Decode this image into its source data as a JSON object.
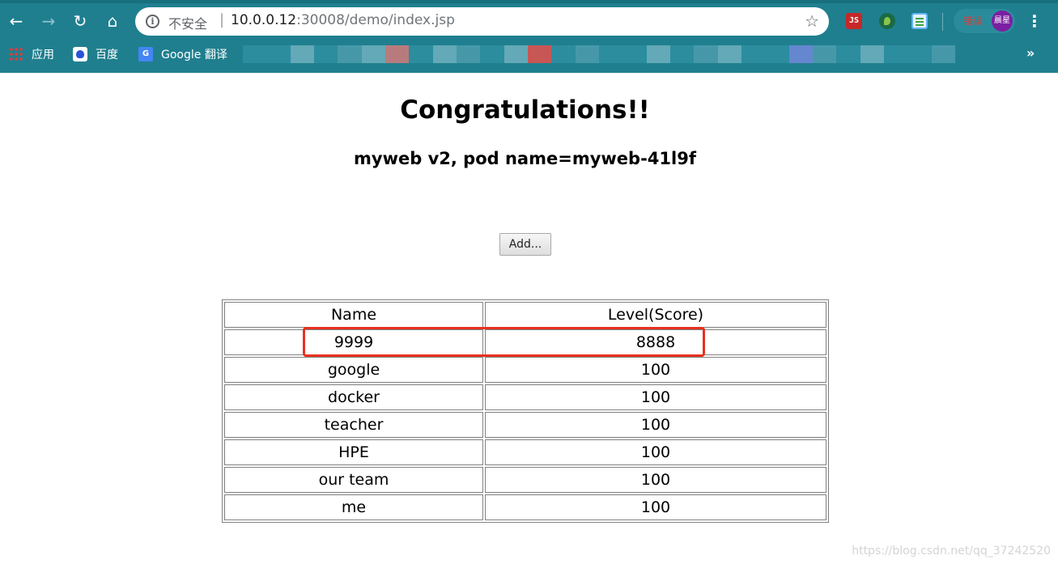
{
  "browser": {
    "security_label": "不安全",
    "separator": "|",
    "url_host": "10.0.0.12",
    "url_path": ":30008/demo/index.jsp",
    "profile_status": "错误",
    "profile_name": "晨星",
    "bookmarks": [
      {
        "label": "应用"
      },
      {
        "label": "百度"
      },
      {
        "label": "Google 翻译"
      }
    ],
    "ext_js_label": "JS",
    "gtrans_icon_label": "G"
  },
  "page": {
    "title": "Congratulations!!",
    "subtitle": "myweb v2, pod name=myweb-41l9f",
    "add_button": "Add..."
  },
  "table": {
    "headers": [
      "Name",
      "Level(Score)"
    ],
    "rows": [
      {
        "name": "9999",
        "score": "8888"
      },
      {
        "name": "google",
        "score": "100"
      },
      {
        "name": "docker",
        "score": "100"
      },
      {
        "name": "teacher",
        "score": "100"
      },
      {
        "name": "HPE",
        "score": "100"
      },
      {
        "name": "our team",
        "score": "100"
      },
      {
        "name": "me",
        "score": "100"
      }
    ]
  },
  "watermark": "https://blog.csdn.net/qq_37242520",
  "colors": {
    "chrome": "#1f7f8f",
    "highlight": "#e8311f"
  }
}
